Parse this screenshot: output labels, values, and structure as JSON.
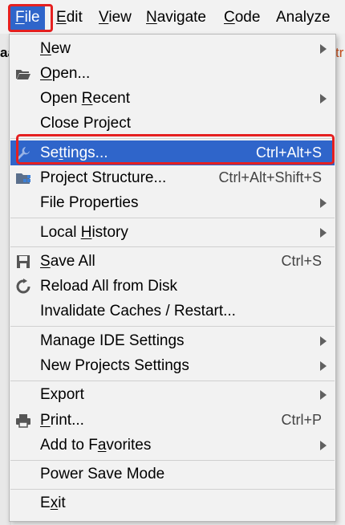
{
  "menubar": {
    "items": [
      {
        "label": "File",
        "mnemonic": "F",
        "rest": "ile"
      },
      {
        "label": "Edit",
        "mnemonic": "E",
        "rest": "dit"
      },
      {
        "label": "View",
        "mnemonic": "V",
        "rest": "iew"
      },
      {
        "label": "Navigate",
        "mnemonic": "N",
        "rest": "avigate"
      },
      {
        "label": "Code",
        "mnemonic": "C",
        "rest": "ode"
      },
      {
        "label": "Analyze",
        "mnemonic": "",
        "rest": "Analyze"
      }
    ]
  },
  "background": {
    "left_fragment": "aa",
    "right_fragment": "tr"
  },
  "colors": {
    "selection": "#2f65ca",
    "highlight_box": "#e52020"
  },
  "file_menu": {
    "items": [
      {
        "pre": "",
        "mn": "N",
        "post": "ew",
        "shortcut": "",
        "submenu": true,
        "icon": ""
      },
      {
        "pre": "",
        "mn": "O",
        "post": "pen...",
        "shortcut": "",
        "submenu": false,
        "icon": "folder-open-icon"
      },
      {
        "pre": "Open ",
        "mn": "R",
        "post": "ecent",
        "shortcut": "",
        "submenu": true,
        "icon": ""
      },
      {
        "pre": "Close Project",
        "mn": "",
        "post": "",
        "shortcut": "",
        "submenu": false,
        "icon": ""
      },
      {
        "pre": "Se",
        "mn": "t",
        "post": "tings...",
        "shortcut": "Ctrl+Alt+S",
        "submenu": false,
        "icon": "wrench-icon"
      },
      {
        "pre": "Project Structure...",
        "mn": "",
        "post": "",
        "shortcut": "Ctrl+Alt+Shift+S",
        "submenu": false,
        "icon": "project-structure-icon"
      },
      {
        "pre": "File Properties",
        "mn": "",
        "post": "",
        "shortcut": "",
        "submenu": true,
        "icon": ""
      },
      {
        "pre": "Local ",
        "mn": "H",
        "post": "istory",
        "shortcut": "",
        "submenu": true,
        "icon": ""
      },
      {
        "pre": "",
        "mn": "S",
        "post": "ave All",
        "shortcut": "Ctrl+S",
        "submenu": false,
        "icon": "save-icon"
      },
      {
        "pre": "Reload All from Disk",
        "mn": "",
        "post": "",
        "shortcut": "",
        "submenu": false,
        "icon": "reload-icon"
      },
      {
        "pre": "Invalidate Caches / Restart...",
        "mn": "",
        "post": "",
        "shortcut": "",
        "submenu": false,
        "icon": ""
      },
      {
        "pre": "Manage IDE Settings",
        "mn": "",
        "post": "",
        "shortcut": "",
        "submenu": true,
        "icon": ""
      },
      {
        "pre": "New Projects Settings",
        "mn": "",
        "post": "",
        "shortcut": "",
        "submenu": true,
        "icon": ""
      },
      {
        "pre": "Export",
        "mn": "",
        "post": "",
        "shortcut": "",
        "submenu": true,
        "icon": ""
      },
      {
        "pre": "",
        "mn": "P",
        "post": "rint...",
        "shortcut": "Ctrl+P",
        "submenu": false,
        "icon": "printer-icon"
      },
      {
        "pre": "Add to F",
        "mn": "a",
        "post": "vorites",
        "shortcut": "",
        "submenu": true,
        "icon": ""
      },
      {
        "pre": "Power Save Mode",
        "mn": "",
        "post": "",
        "shortcut": "",
        "submenu": false,
        "icon": ""
      },
      {
        "pre": "E",
        "mn": "x",
        "post": "it",
        "shortcut": "",
        "submenu": false,
        "icon": ""
      }
    ]
  }
}
